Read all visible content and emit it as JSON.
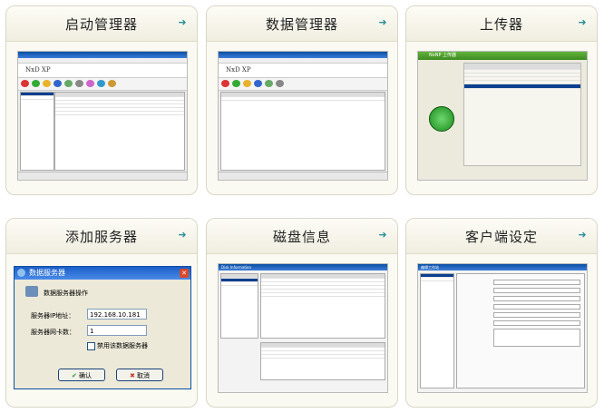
{
  "cards": [
    {
      "title": "启动管理器"
    },
    {
      "title": "数据管理器"
    },
    {
      "title": "上传器"
    },
    {
      "title": "添加服务器"
    },
    {
      "title": "磁盘信息"
    },
    {
      "title": "客户端设定"
    }
  ],
  "arrow_glyph": "➜",
  "accent_color": "#2a8f9a",
  "add_server": {
    "title": "数据服务器",
    "heading": "数据服务器操作",
    "ip_label": "服务器IP地址：",
    "ip_value": "192.168.10.181",
    "nic_label": "服务器网卡数：",
    "nic_value": "1",
    "disable_label": "禁用该数据服务器",
    "ok_label": "确认",
    "cancel_label": "取消"
  },
  "thumbs": {
    "boot_logo": "NxD XP",
    "data_logo": "NxD XP",
    "uploader_title": "NxNP 上传器",
    "disk_title": "Disk Information",
    "client_title": "编辑工作站"
  }
}
